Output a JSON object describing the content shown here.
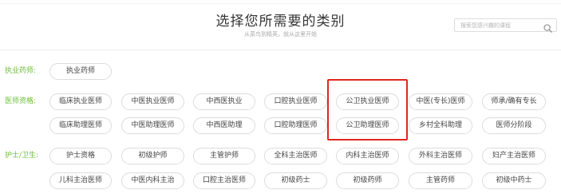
{
  "header": {
    "title": "选择您所需要的类别",
    "subtitle": "从菜鸟到精英，就从这里开始"
  },
  "search": {
    "placeholder": "搜索您感兴趣的课程"
  },
  "icons": {
    "search": "search-icon"
  },
  "colors": {
    "label_green": "#6cbf3a",
    "highlight_red": "#e0281f",
    "tag_border": "#dcdcdc"
  },
  "categories": [
    {
      "label": "执业药师:",
      "tags": [
        "执业药师"
      ]
    },
    {
      "label": "医师资格:",
      "tags": [
        "临床执业医师",
        "中医执业医师",
        "中西医执业",
        "口腔执业医师",
        "公卫执业医师",
        "中医(专长)医师",
        "师承/确有专长",
        "临床助理医师",
        "中医助理医师",
        "中西医助理",
        "口腔助理医师",
        "公卫助理医师",
        "乡村全科助理",
        "医师分阶段"
      ]
    },
    {
      "label": "护士/卫生:",
      "tags": [
        "护士资格",
        "初级护师",
        "主管护师",
        "全科主治医师",
        "内科主治医师",
        "外科主治医师",
        "妇产主治医师",
        "儿科主治医师",
        "中医内科主治",
        "口腔主治医师",
        "初级药士",
        "初级药师",
        "主管药师",
        "初级中药士"
      ]
    }
  ]
}
